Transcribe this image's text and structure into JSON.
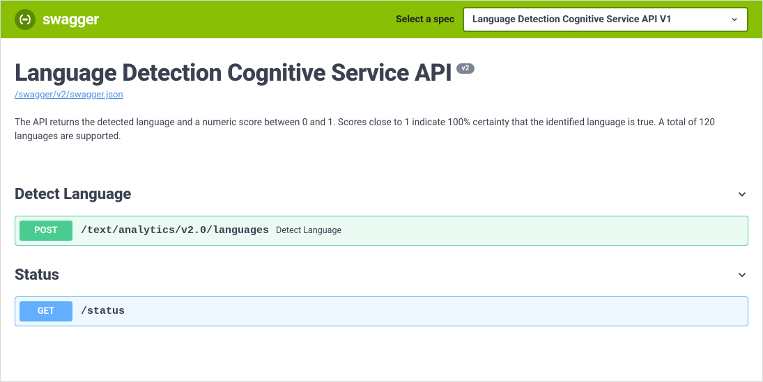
{
  "topbar": {
    "brand_text": "swagger",
    "spec_label": "Select a spec",
    "spec_selected": "Language Detection Cognitive Service API V1"
  },
  "api": {
    "title": "Language Detection Cognitive Service API",
    "version_badge": "v2",
    "json_link": "/swagger/v2/swagger.json",
    "description": "The API returns the detected language and a numeric score between 0 and 1. Scores close to 1 indicate 100% certainty that the identified language is true. A total of 120 languages are supported."
  },
  "tags": {
    "detect_language": {
      "name": "Detect Language",
      "operations": [
        {
          "method": "POST",
          "path": "/text/analytics/v2.0/languages",
          "summary": "Detect Language"
        }
      ]
    },
    "status": {
      "name": "Status",
      "operations": [
        {
          "method": "GET",
          "path": "/status",
          "summary": ""
        }
      ]
    }
  }
}
